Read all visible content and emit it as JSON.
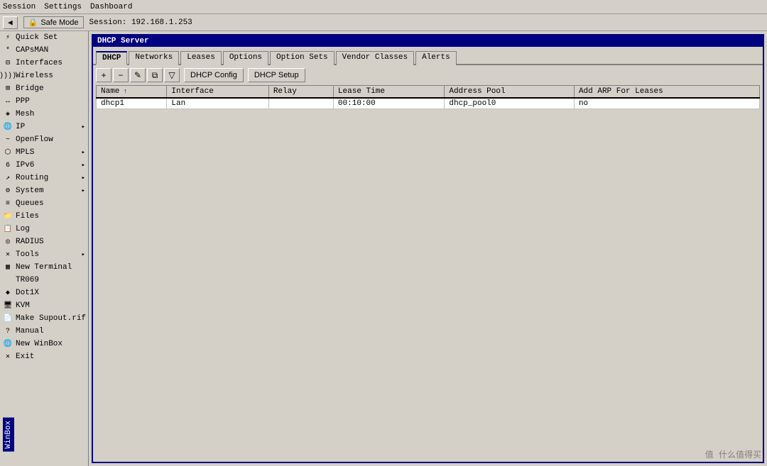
{
  "menu": {
    "items": [
      "Session",
      "Settings",
      "Dashboard"
    ]
  },
  "toolbar": {
    "back_label": "◀",
    "safe_mode_label": "Safe Mode",
    "session_prefix": "Session:",
    "session_value": "192.168.1.253"
  },
  "sidebar": {
    "items": [
      {
        "id": "quick-set",
        "label": "Quick Set",
        "icon": "⚡",
        "submenu": false
      },
      {
        "id": "capsman",
        "label": "CAPsMAN",
        "icon": "📡",
        "submenu": false
      },
      {
        "id": "interfaces",
        "label": "Interfaces",
        "icon": "🔌",
        "submenu": false
      },
      {
        "id": "wireless",
        "label": "Wireless",
        "icon": "((•))",
        "submenu": false
      },
      {
        "id": "bridge",
        "label": "Bridge",
        "icon": "⊞",
        "submenu": false
      },
      {
        "id": "ppp",
        "label": "PPP",
        "icon": "↔",
        "submenu": false
      },
      {
        "id": "mesh",
        "label": "Mesh",
        "icon": "◈",
        "submenu": false
      },
      {
        "id": "ip",
        "label": "IP",
        "icon": "🌐",
        "submenu": true
      },
      {
        "id": "openflow",
        "label": "OpenFlow",
        "icon": "~",
        "submenu": false
      },
      {
        "id": "mpls",
        "label": "MPLS",
        "icon": "⬡",
        "submenu": true
      },
      {
        "id": "ipv6",
        "label": "IPv6",
        "icon": "6",
        "submenu": true
      },
      {
        "id": "routing",
        "label": "Routing",
        "icon": "↗",
        "submenu": true
      },
      {
        "id": "system",
        "label": "System",
        "icon": "⚙",
        "submenu": true
      },
      {
        "id": "queues",
        "label": "Queues",
        "icon": "≡",
        "submenu": false
      },
      {
        "id": "files",
        "label": "Files",
        "icon": "📁",
        "submenu": false
      },
      {
        "id": "log",
        "label": "Log",
        "icon": "📋",
        "submenu": false
      },
      {
        "id": "radius",
        "label": "RADIUS",
        "icon": "◎",
        "submenu": false
      },
      {
        "id": "tools",
        "label": "Tools",
        "icon": "🔧",
        "submenu": true
      },
      {
        "id": "new-terminal",
        "label": "New Terminal",
        "icon": "▦",
        "submenu": false
      },
      {
        "id": "tr069",
        "label": "TR069",
        "icon": "",
        "submenu": false
      },
      {
        "id": "dot1x",
        "label": "Dot1X",
        "icon": "◆",
        "submenu": false
      },
      {
        "id": "kvm",
        "label": "KVM",
        "icon": "🖥",
        "submenu": false
      },
      {
        "id": "make-supout",
        "label": "Make Supout.rif",
        "icon": "📄",
        "submenu": false
      },
      {
        "id": "manual",
        "label": "Manual",
        "icon": "?",
        "submenu": false
      },
      {
        "id": "new-winbox",
        "label": "New WinBox",
        "icon": "🌐",
        "submenu": false
      },
      {
        "id": "exit",
        "label": "Exit",
        "icon": "✕",
        "submenu": false
      }
    ]
  },
  "dhcp_window": {
    "title": "DHCP Server",
    "tabs": [
      "DHCP",
      "Networks",
      "Leases",
      "Options",
      "Option Sets",
      "Vendor Classes",
      "Alerts"
    ],
    "active_tab": "DHCP",
    "buttons": {
      "dhcp_config": "DHCP Config",
      "dhcp_setup": "DHCP Setup"
    },
    "table": {
      "columns": [
        "Name",
        "Interface",
        "Relay",
        "Lease Time",
        "Address Pool",
        "Add ARP For Leases"
      ],
      "rows": [
        {
          "name": "dhcp1",
          "interface": "Lan",
          "relay": "",
          "lease_time": "00:10:00",
          "address_pool": "dhcp_pool0",
          "add_arp": "no"
        }
      ]
    }
  },
  "winbox_label": "WinBox",
  "watermark": "值 什么值得买"
}
